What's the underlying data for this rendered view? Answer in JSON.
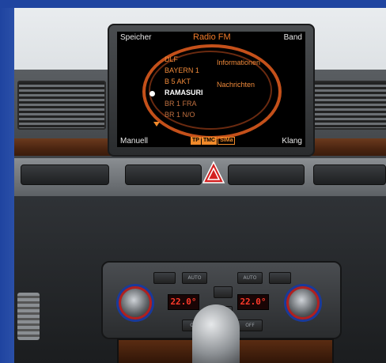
{
  "mmi": {
    "top_left": "Speicher",
    "title": "Radio FM",
    "top_right": "Band",
    "bottom_left": "Manuell",
    "bottom_right": "Klang",
    "stations": [
      "DLF",
      "BAYERN 1",
      "B 5 AKT",
      "RAMASURI",
      "BR 1 FRA",
      "BR 1 N/O"
    ],
    "selected_station": "RAMASURI",
    "options": [
      "Informationen",
      "Nachrichten"
    ],
    "badges": [
      "TP",
      "TMC",
      "SiMa"
    ]
  },
  "climate": {
    "left_temp": "22.0°",
    "right_temp": "22.0°",
    "left_auto": "AUTO",
    "right_auto": "AUTO",
    "left_off": "OFF",
    "right_off": "OFF"
  },
  "colors": {
    "accent": "#f08a2a",
    "frame": "#1e3f8f",
    "display_red": "#ff3a2a"
  }
}
